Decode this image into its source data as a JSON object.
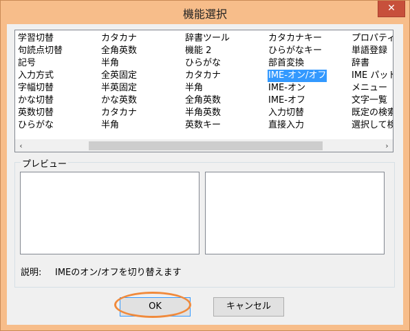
{
  "window": {
    "title": "機能選択",
    "close_glyph": "✕",
    "accent": "#f7bd8a",
    "close_color": "#c7503b"
  },
  "list": {
    "columns": [
      [
        "学習切替",
        "句読点切替",
        "記号",
        "入力方式",
        "字幅切替",
        "かな切替",
        "英数切替",
        "ひらがな"
      ],
      [
        "カタカナ",
        "全角英数",
        "半角",
        "全英固定",
        "半英固定",
        "かな英数",
        "カタカナ",
        "半角"
      ],
      [
        "辞書ツール",
        "機能 2",
        "ひらがな",
        "カタカナ",
        "半角",
        "全角英数",
        "半角英数",
        "英数キー"
      ],
      [
        "カタカナキー",
        "ひらがなキー",
        "部首変換",
        "IME-オン/オフ",
        "IME-オン",
        "IME-オフ",
        "入力切替",
        "直接入力"
      ],
      [
        "プロパティ",
        "単語登録",
        "辞書",
        "IME パッド",
        "メニュー",
        "文字一覧",
        "既定の検索",
        "選択して検索"
      ]
    ],
    "selected": {
      "col": 3,
      "row": 3
    },
    "selection_color": "#3399ff",
    "scroll_left_icon": "‹",
    "scroll_right_icon": "›"
  },
  "preview": {
    "label": "プレビュー"
  },
  "description": {
    "label": "説明:",
    "text": "IMEのオン/オフを切り替えます"
  },
  "buttons": {
    "ok_label": "OK",
    "cancel_label": "キャンセル"
  }
}
